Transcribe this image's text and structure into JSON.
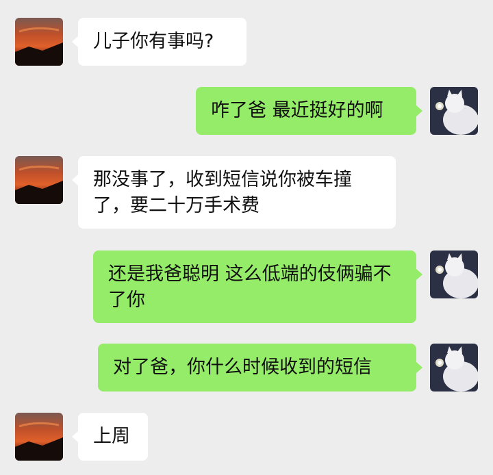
{
  "colors": {
    "background": "#ededed",
    "incoming_bubble": "#ffffff",
    "outgoing_bubble": "#95ec69"
  },
  "avatars": {
    "contact": "sunset-avatar-icon",
    "self": "white-cat-avatar-icon"
  },
  "messages": [
    {
      "sender": "contact",
      "text": "儿子你有事吗?"
    },
    {
      "sender": "self",
      "text": "咋了爸 最近挺好的啊"
    },
    {
      "sender": "contact",
      "text": "那没事了，收到短信说你被车撞了，要二十万手术费"
    },
    {
      "sender": "self",
      "text": "还是我爸聪明 这么低端的伎俩骗不了你"
    },
    {
      "sender": "self",
      "text": "对了爸，你什么时候收到的短信"
    },
    {
      "sender": "contact",
      "text": "上周"
    }
  ]
}
